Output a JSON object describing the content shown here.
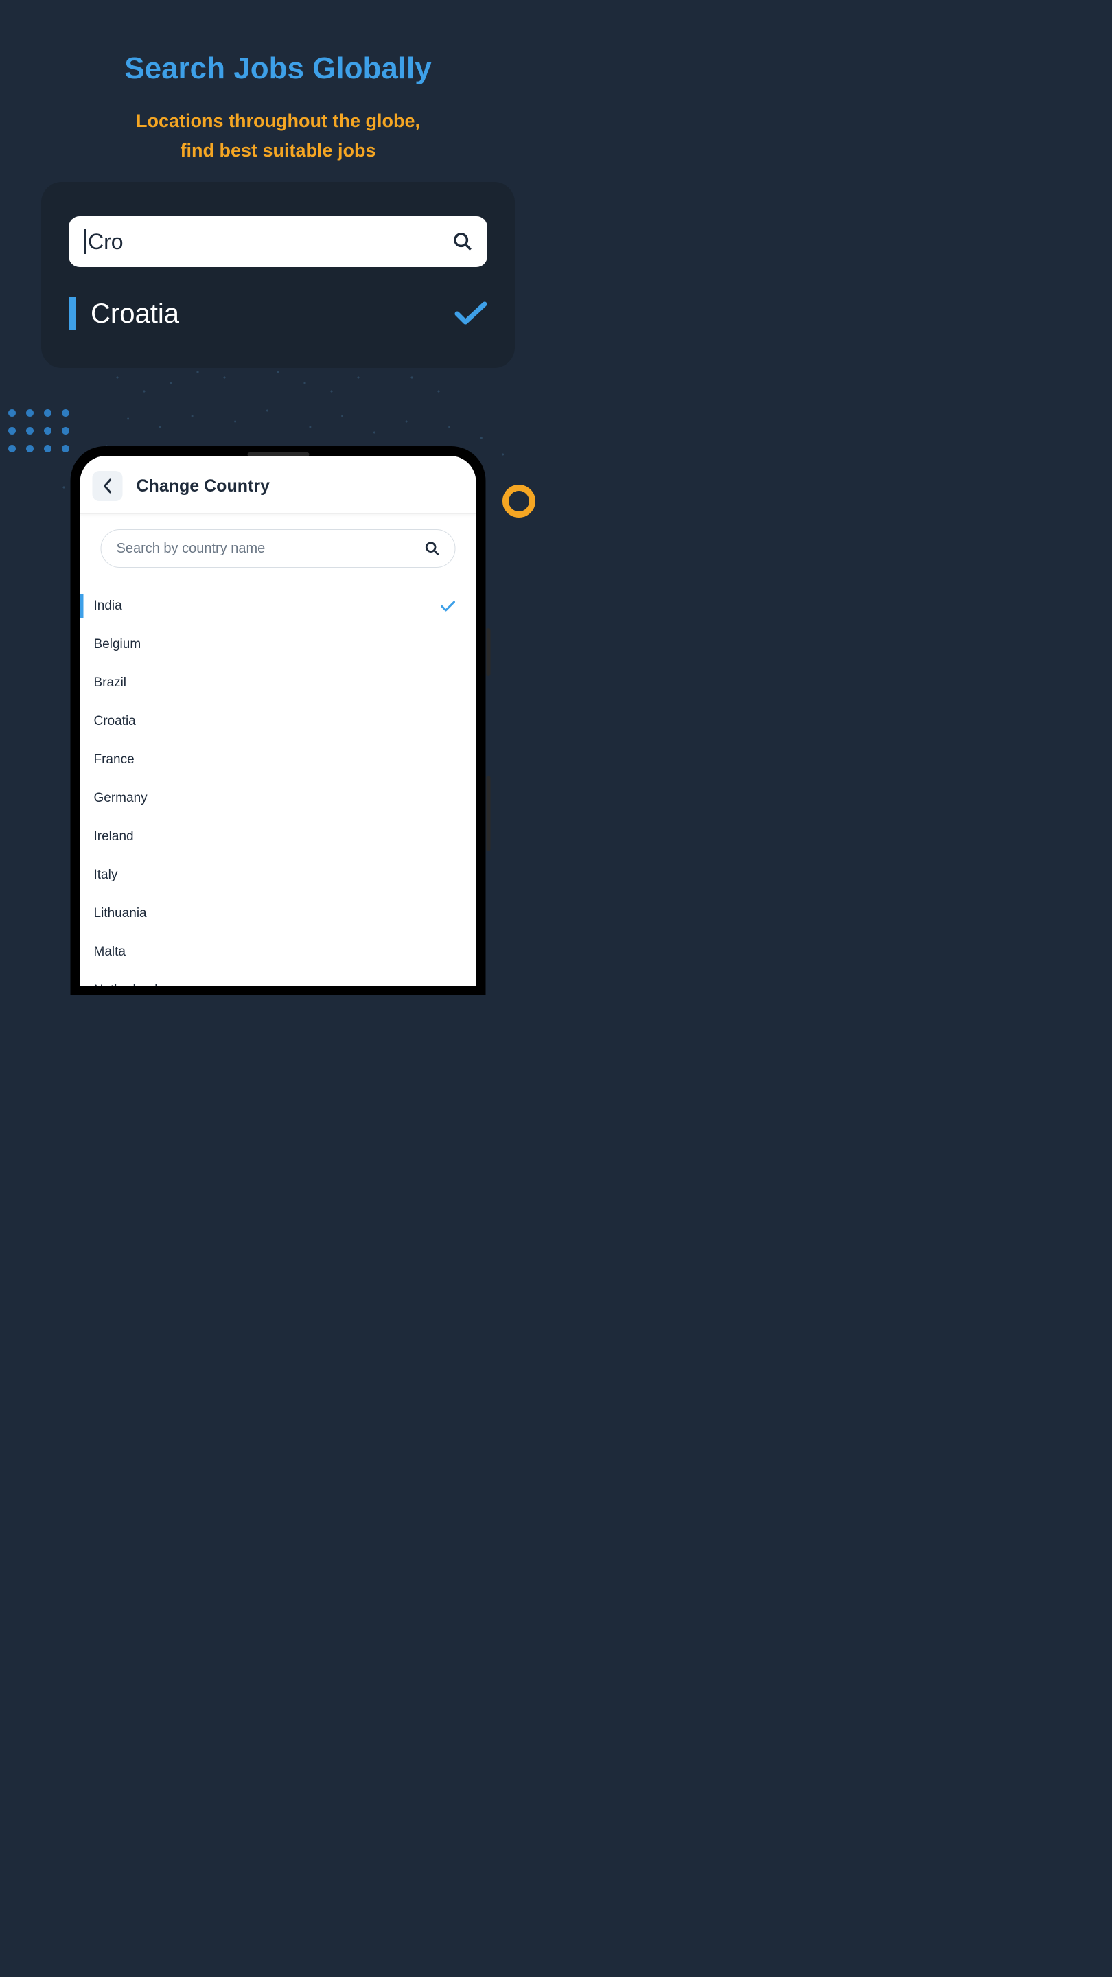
{
  "header": {
    "title": "Search Jobs Globally",
    "subtitle_line1": "Locations throughout the globe,",
    "subtitle_line2": "find best suitable jobs"
  },
  "searchCard": {
    "inputValue": "Cro",
    "resultLabel": "Croatia"
  },
  "phone": {
    "headerTitle": "Change Country",
    "searchPlaceholder": "Search by country name",
    "countries": [
      {
        "name": "India",
        "selected": true
      },
      {
        "name": "Belgium",
        "selected": false
      },
      {
        "name": "Brazil",
        "selected": false
      },
      {
        "name": "Croatia",
        "selected": false
      },
      {
        "name": "France",
        "selected": false
      },
      {
        "name": "Germany",
        "selected": false
      },
      {
        "name": "Ireland",
        "selected": false
      },
      {
        "name": "Italy",
        "selected": false
      },
      {
        "name": "Lithuania",
        "selected": false
      },
      {
        "name": "Malta",
        "selected": false
      },
      {
        "name": "Netherlands",
        "selected": false
      }
    ]
  },
  "colors": {
    "background": "#1e2a3a",
    "accentBlue": "#3ea0e8",
    "accentOrange": "#f5a623"
  }
}
